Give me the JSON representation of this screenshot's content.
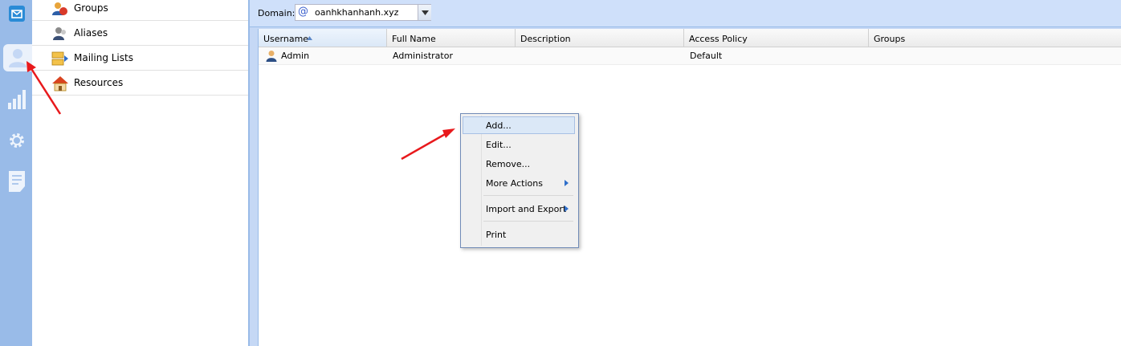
{
  "nav": {
    "items": [
      {
        "label": "Groups",
        "icon": "groups-icon"
      },
      {
        "label": "Aliases",
        "icon": "aliases-icon"
      },
      {
        "label": "Mailing Lists",
        "icon": "mailing-lists-icon"
      },
      {
        "label": "Resources",
        "icon": "resources-icon"
      }
    ]
  },
  "rail": {
    "items": [
      "mail-icon",
      "users-icon",
      "statistics-icon",
      "settings-icon",
      "logs-icon"
    ],
    "active": "users-icon"
  },
  "toolbar": {
    "domain_label": "Domain:",
    "domain_value": "oanhkhanhanh.xyz"
  },
  "grid": {
    "columns": [
      "Username",
      "Full Name",
      "Description",
      "Access Policy",
      "Groups"
    ],
    "sorted_column": "Username",
    "sort_direction": "ascending",
    "rows": [
      {
        "username": "Admin",
        "full_name": "Administrator",
        "description": "",
        "access_policy": "Default",
        "groups": ""
      }
    ]
  },
  "context_menu": {
    "items": [
      {
        "label": "Add...",
        "highlighted": true
      },
      {
        "label": "Edit..."
      },
      {
        "label": "Remove..."
      },
      {
        "label": "More Actions",
        "submenu": true
      },
      {
        "label": "Import and Export",
        "submenu": true
      },
      {
        "label": "Print"
      }
    ]
  },
  "colors": {
    "rail": "#99bbe8",
    "toolbar": "#cfe0fa",
    "annotation_arrow": "#e8191c"
  }
}
